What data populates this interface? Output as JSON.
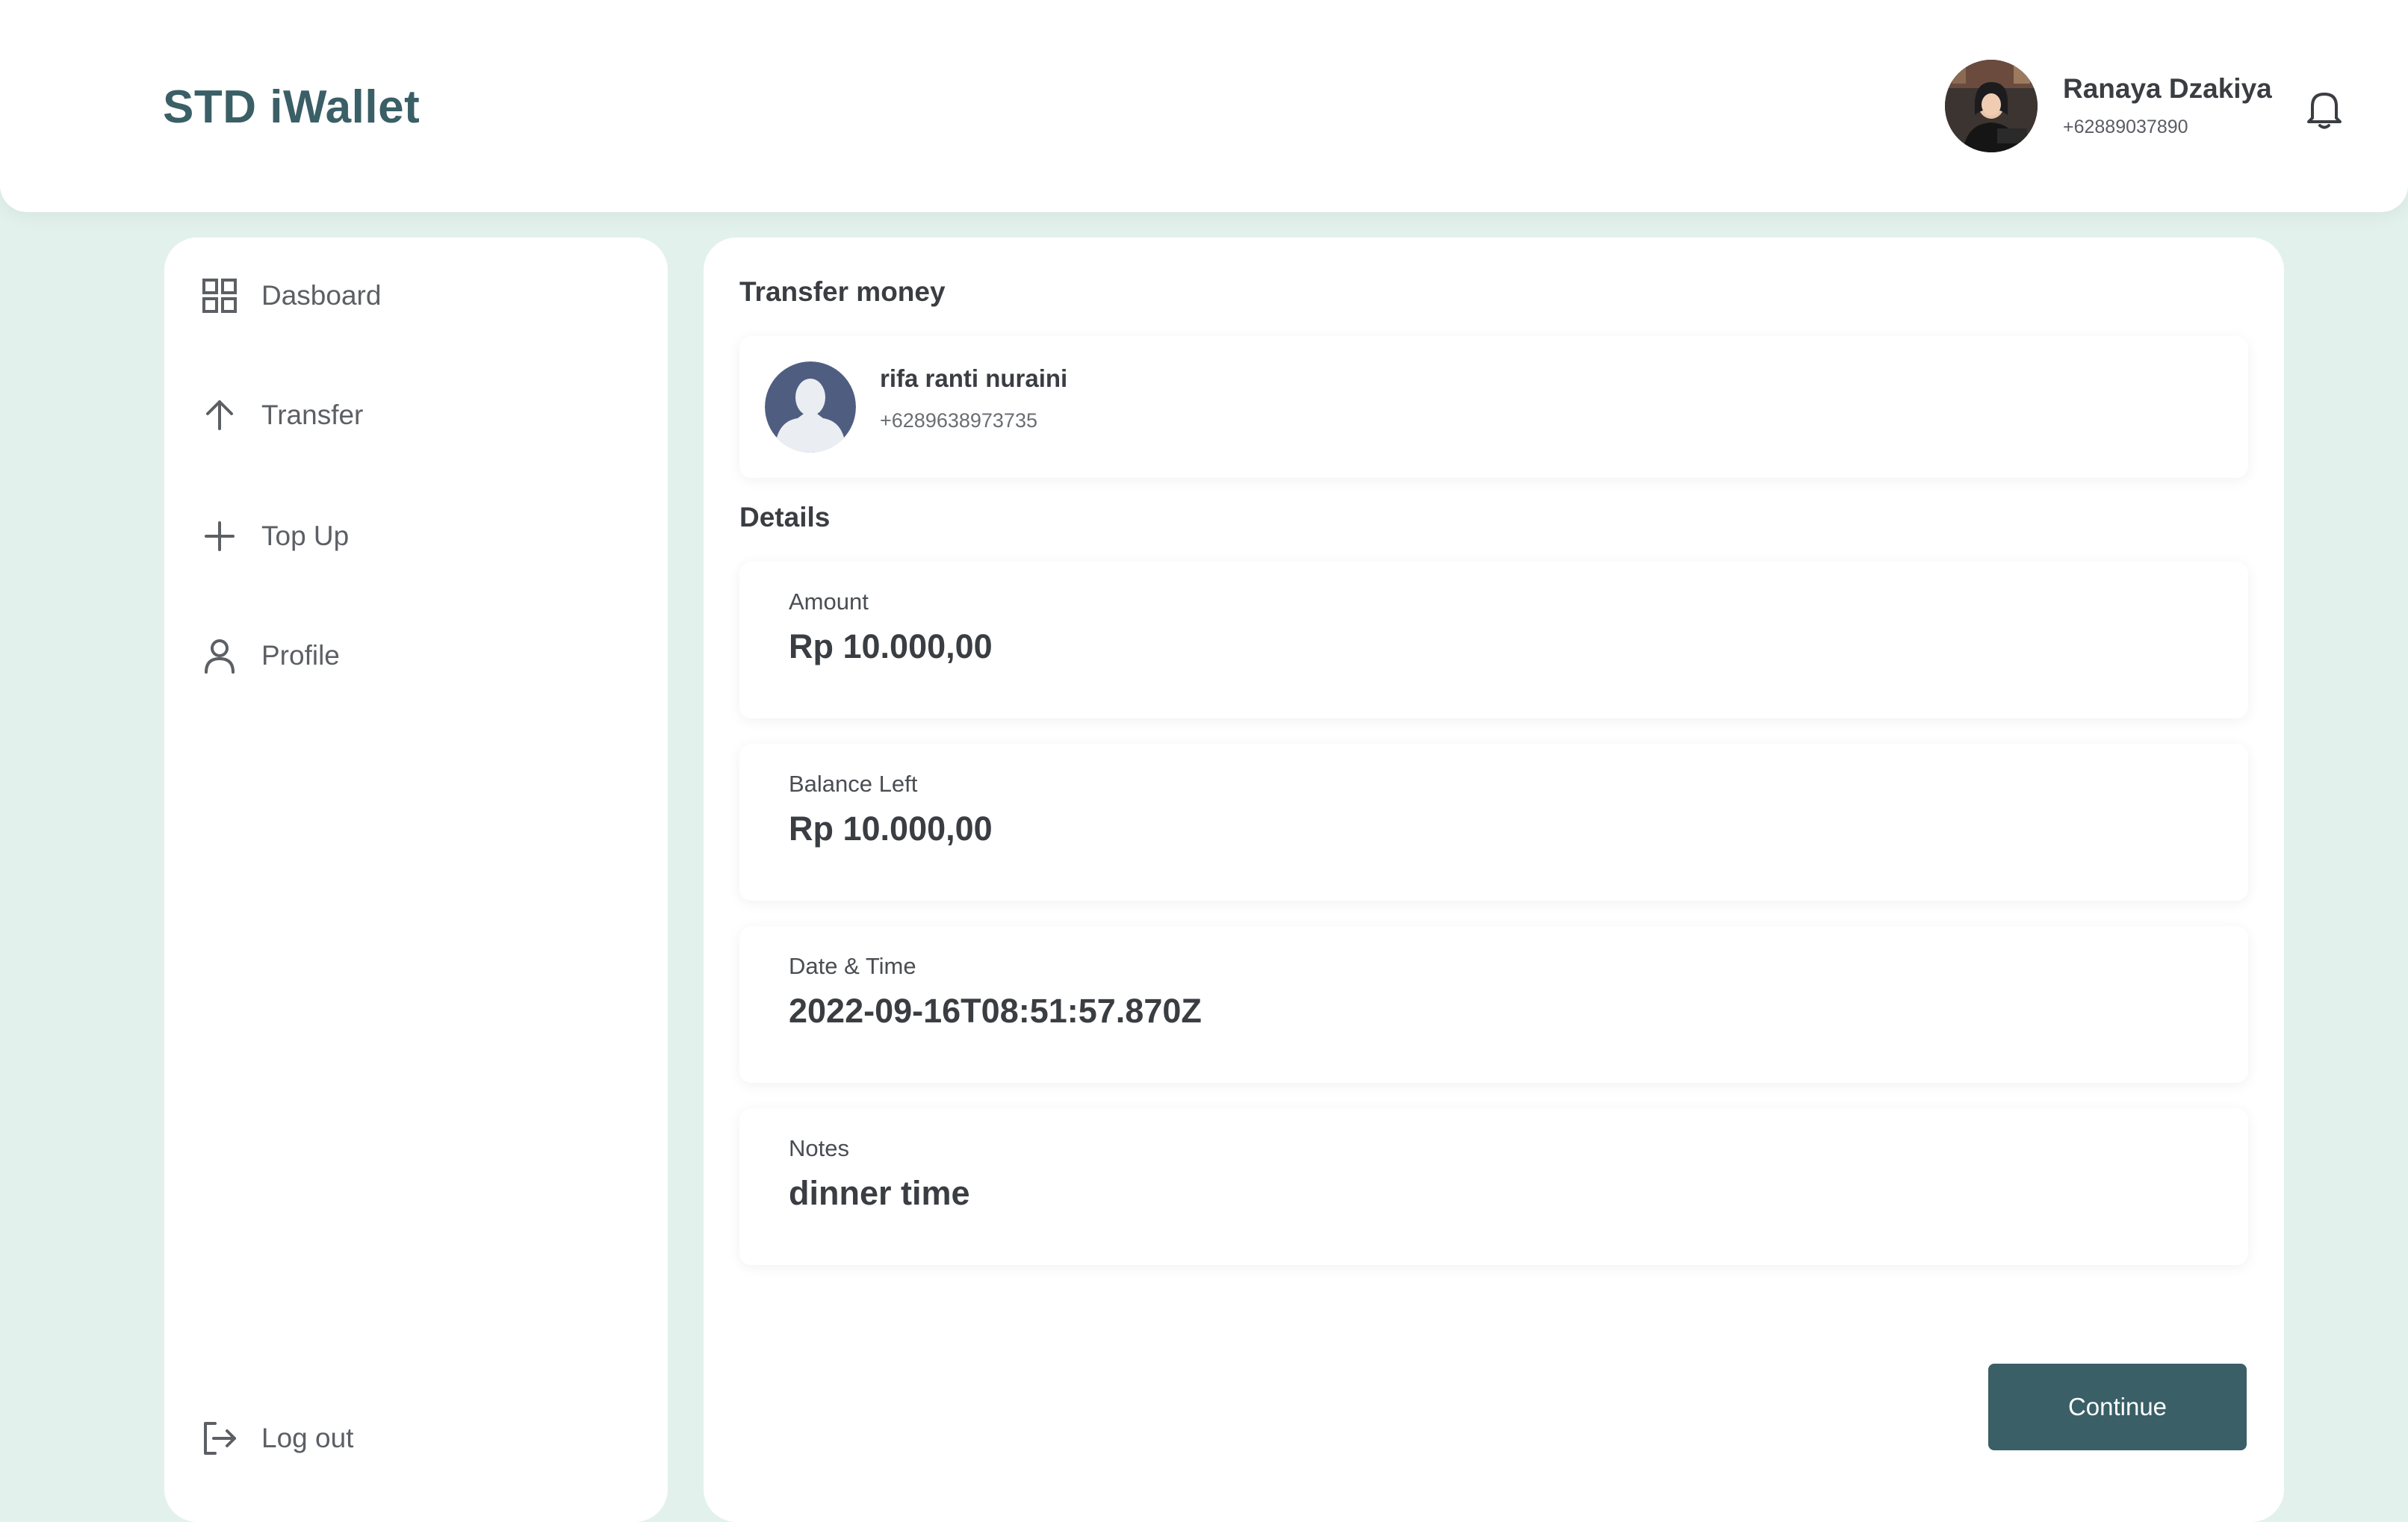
{
  "app": {
    "brand": "STD iWallet"
  },
  "header": {
    "user": {
      "name": "Ranaya Dzakiya",
      "phone": "+62889037890",
      "avatar_icon": "user-photo"
    },
    "notification_icon": "bell-icon"
  },
  "sidebar": {
    "items": [
      {
        "label": "Dasboard",
        "icon": "grid-icon"
      },
      {
        "label": "Transfer",
        "icon": "arrow-up-icon"
      },
      {
        "label": "Top Up",
        "icon": "plus-icon"
      },
      {
        "label": "Profile",
        "icon": "user-icon"
      }
    ],
    "logout": {
      "label": "Log out",
      "icon": "logout-icon"
    }
  },
  "main": {
    "title": "Transfer money",
    "recipient": {
      "name": "rifa ranti nuraini",
      "phone": "+6289638973735",
      "avatar_icon": "default-avatar-icon"
    },
    "details_title": "Details",
    "details": [
      {
        "label": "Amount",
        "value": "Rp 10.000,00"
      },
      {
        "label": "Balance Left",
        "value": "Rp 10.000,00"
      },
      {
        "label": "Date & Time",
        "value": "2022-09-16T08:51:57.870Z"
      },
      {
        "label": "Notes",
        "value": "dinner time"
      }
    ],
    "continue_label": "Continue"
  },
  "colors": {
    "background": "#e3f1ed",
    "brand": "#3a5f66",
    "button": "#3a5f66",
    "avatar_default": "#4f5e80"
  }
}
